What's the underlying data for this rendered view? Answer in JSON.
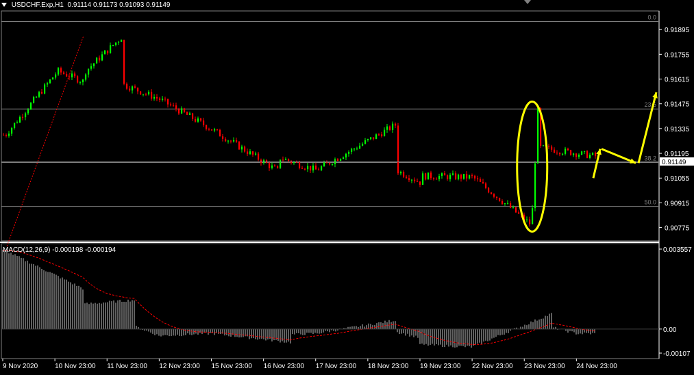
{
  "window": {
    "symbol": "USDCHF.Exp,H1",
    "ohlc": [
      "0.91114",
      "0.91173",
      "0.91093",
      "0.91149"
    ]
  },
  "price_scale": {
    "ticks": [
      "0.91895",
      "0.91755",
      "0.91615",
      "0.91475",
      "0.91335",
      "0.91195",
      "0.91055",
      "0.90915",
      "0.90775"
    ],
    "current_price": "0.91149"
  },
  "fibonacci": {
    "levels": [
      "0.0",
      "23.6",
      "38.2",
      "50.0"
    ]
  },
  "macd": {
    "label": "MACD(12,26,9)",
    "main_value": "-0.000198",
    "signal_value": "-0.000194",
    "ticks": [
      "0.003557",
      "0.00",
      "-0.00107"
    ]
  },
  "time_axis": {
    "labels": [
      "9 Nov 2020",
      "10 Nov 23:00",
      "11 Nov 23:00",
      "12 Nov 23:00",
      "15 Nov 23:00",
      "16 Nov 23:00",
      "17 Nov 23:00",
      "18 Nov 23:00",
      "19 Nov 23:00",
      "22 Nov 23:00",
      "23 Nov 23:00",
      "24 Nov 23:00"
    ]
  },
  "colors": {
    "background": "#000000",
    "bull": "#00ff00",
    "bear": "#ff0000",
    "grid": "#808080",
    "histogram": "#c0c0c0",
    "signal": "#ff0000",
    "annotation": "#ffff00"
  },
  "chart_data": {
    "type": "candlestick",
    "title": "USDCHF.Exp,H1",
    "x_range": [
      "9 Nov 2020",
      "24 Nov 23:00"
    ],
    "ylim": [
      0.907,
      0.92
    ],
    "fib_levels": [
      {
        "label": "0.0",
        "price": 0.9194
      },
      {
        "label": "23.6",
        "price": 0.91446
      },
      {
        "label": "38.2",
        "price": 0.91143
      },
      {
        "label": "50.0",
        "price": 0.90895
      }
    ],
    "close_path": [
      {
        "x": "9 Nov 2020",
        "y": 0.913
      },
      {
        "x": "10 Nov 00:00",
        "y": 0.9166
      },
      {
        "x": "10 Nov 12:00",
        "y": 0.916
      },
      {
        "x": "10 Nov 23:00",
        "y": 0.915
      },
      {
        "x": "11 Nov 06:00",
        "y": 0.9186
      },
      {
        "x": "11 Nov 23:00",
        "y": 0.9162
      },
      {
        "x": "12 Nov 23:00",
        "y": 0.915
      },
      {
        "x": "15 Nov 23:00",
        "y": 0.9133
      },
      {
        "x": "16 Nov 06:00",
        "y": 0.9109
      },
      {
        "x": "16 Nov 23:00",
        "y": 0.912
      },
      {
        "x": "17 Nov 23:00",
        "y": 0.911
      },
      {
        "x": "18 Nov 12:00",
        "y": 0.9136
      },
      {
        "x": "18 Nov 23:00",
        "y": 0.9118
      },
      {
        "x": "19 Nov 23:00",
        "y": 0.9103
      },
      {
        "x": "20 Nov 12:00",
        "y": 0.9112
      },
      {
        "x": "22 Nov 23:00",
        "y": 0.9106
      },
      {
        "x": "23 Nov 02:00",
        "y": 0.9079
      },
      {
        "x": "23 Nov 05:00",
        "y": 0.9145
      },
      {
        "x": "23 Nov 23:00",
        "y": 0.9124
      },
      {
        "x": "24 Nov 12:00",
        "y": 0.9117
      },
      {
        "x": "24 Nov 23:00",
        "y": 0.91149
      }
    ],
    "macd_range": [
      -0.00107,
      0.003557
    ],
    "macd_histogram_path": [
      {
        "x": "9 Nov 2020",
        "y": 0.0035
      },
      {
        "x": "10 Nov 12:00",
        "y": 0.0018
      },
      {
        "x": "10 Nov 23:00",
        "y": 0.001
      },
      {
        "x": "11 Nov 12:00",
        "y": 0.0013
      },
      {
        "x": "11 Nov 23:00",
        "y": 0.0006
      },
      {
        "x": "12 Nov 23:00",
        "y": -0.0003
      },
      {
        "x": "15 Nov 23:00",
        "y": -0.0002
      },
      {
        "x": "16 Nov 12:00",
        "y": -0.0006
      },
      {
        "x": "16 Nov 23:00",
        "y": -0.0003
      },
      {
        "x": "17 Nov 23:00",
        "y": -0.0002
      },
      {
        "x": "18 Nov 12:00",
        "y": 0.0004
      },
      {
        "x": "18 Nov 23:00",
        "y": 0.0002
      },
      {
        "x": "19 Nov 23:00",
        "y": -0.0004
      },
      {
        "x": "20 Nov 12:00",
        "y": 0.0001
      },
      {
        "x": "22 Nov 23:00",
        "y": -0.0008
      },
      {
        "x": "23 Nov 12:00",
        "y": 0.0007
      },
      {
        "x": "23 Nov 23:00",
        "y": 0.0004
      },
      {
        "x": "24 Nov 23:00",
        "y": -0.0002
      }
    ],
    "annotations": [
      "yellow ellipse around 23 Nov spike",
      "yellow projection arrows"
    ]
  }
}
